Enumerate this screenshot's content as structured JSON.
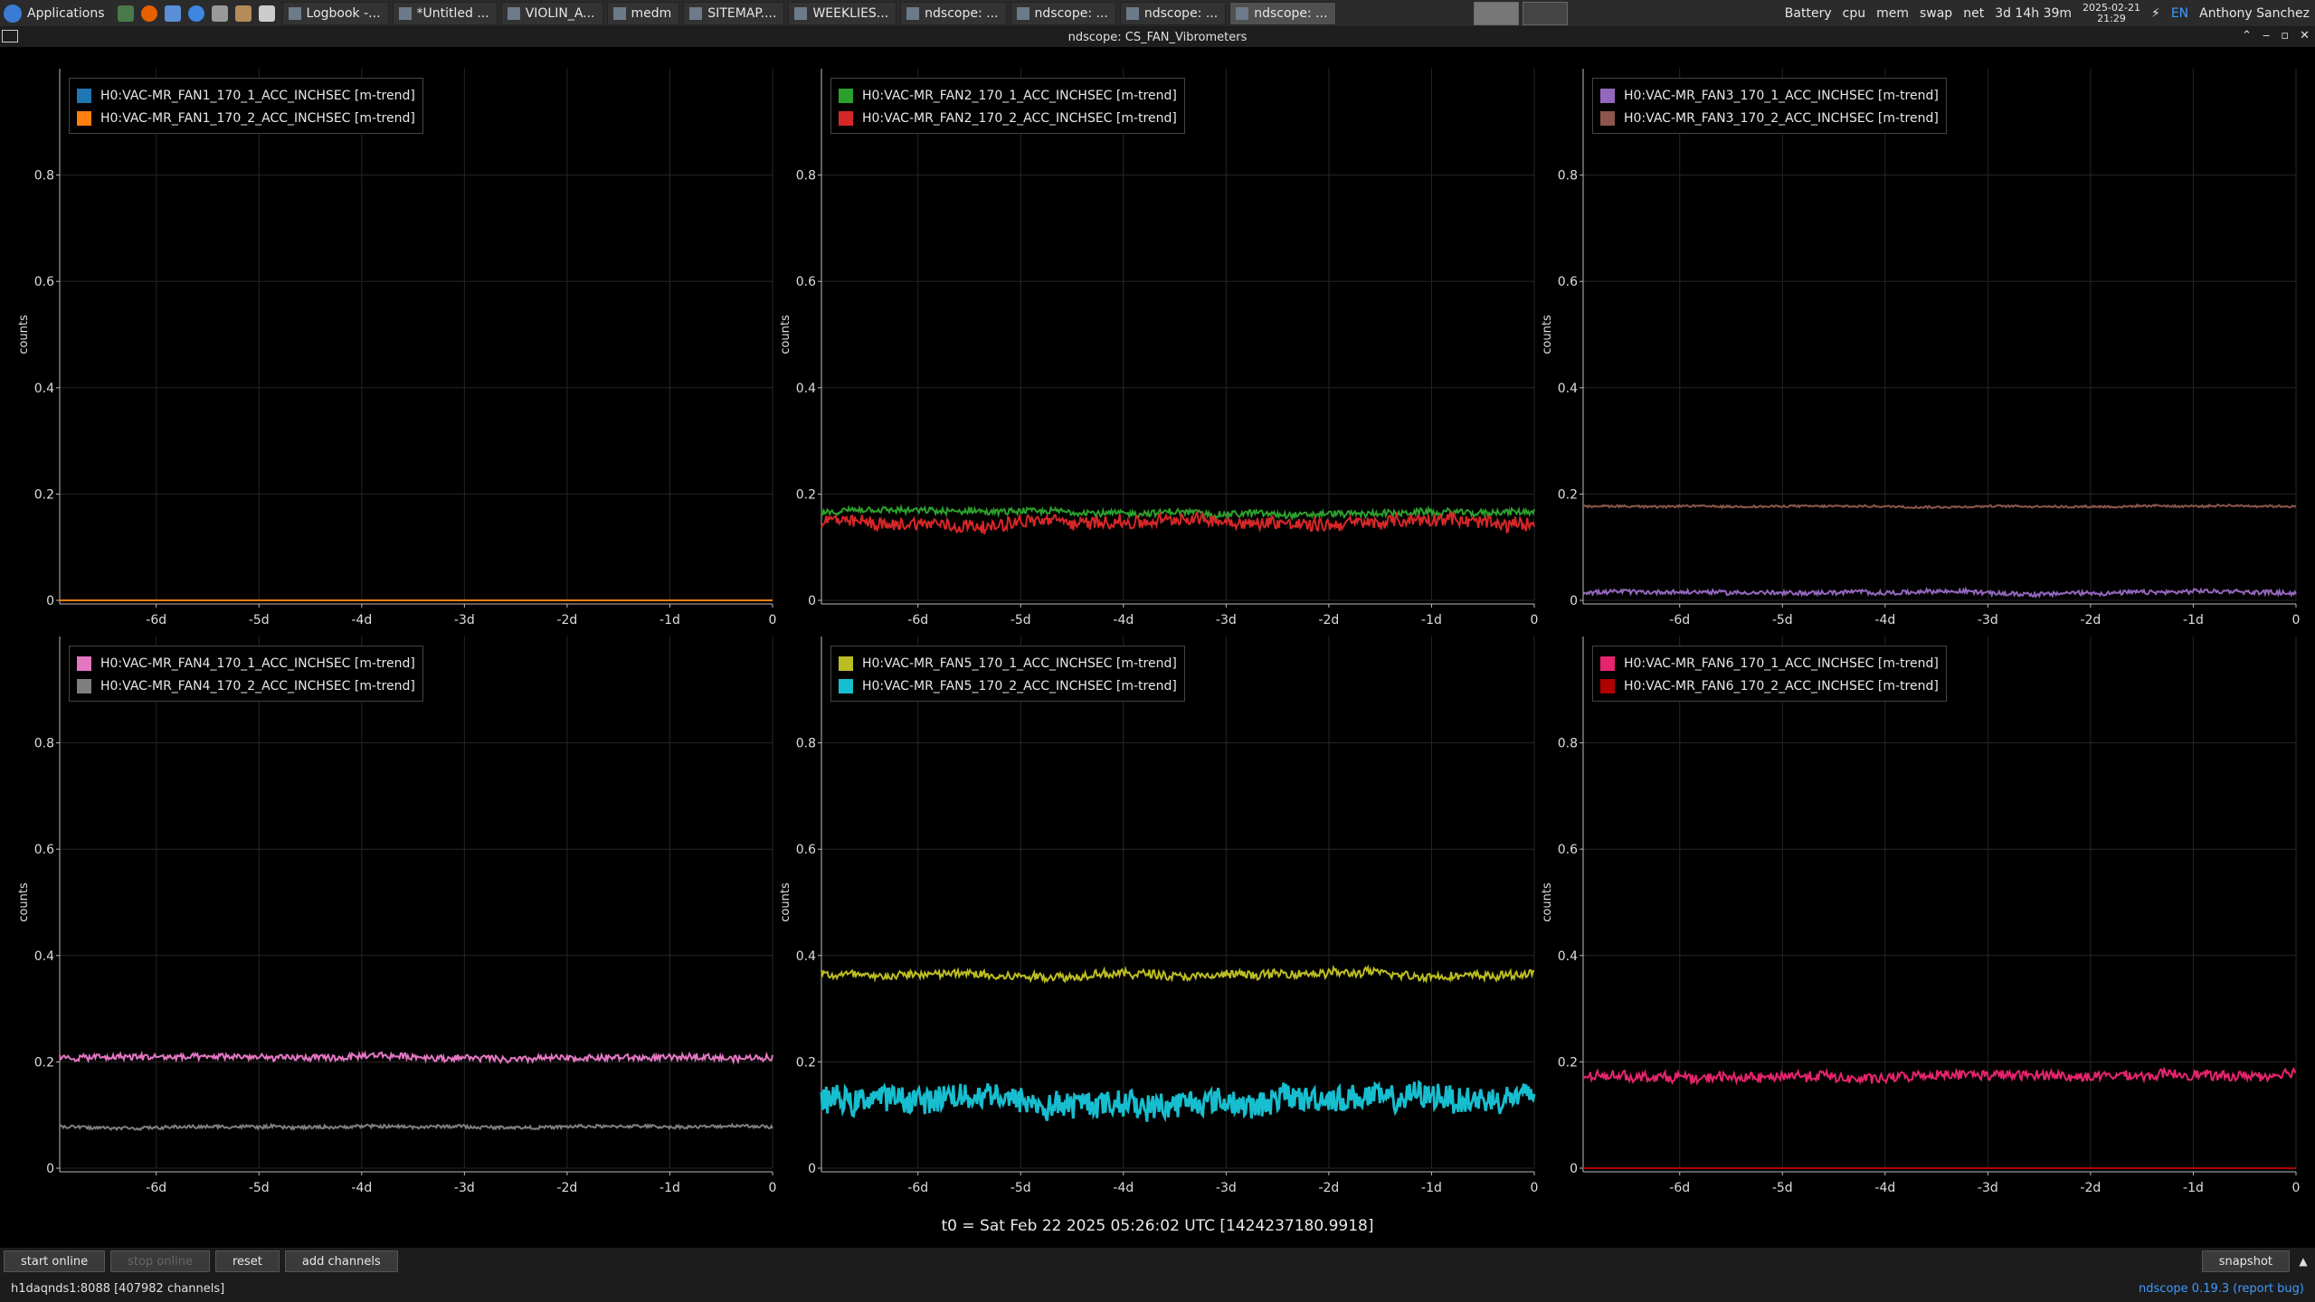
{
  "taskbar": {
    "apps_label": "Applications",
    "tasks": [
      {
        "label": "Logbook -..."
      },
      {
        "label": "*Untitled ..."
      },
      {
        "label": "VIOLIN_A..."
      },
      {
        "label": "medm"
      },
      {
        "label": "SITEMAP...."
      },
      {
        "label": "WEEKLIES..."
      },
      {
        "label": "ndscope: ..."
      },
      {
        "label": "ndscope: ..."
      },
      {
        "label": "ndscope: ..."
      },
      {
        "label": "ndscope: ..."
      }
    ],
    "battery": "Battery",
    "cpu": "cpu",
    "mem": "mem",
    "swap": "swap",
    "net": "net",
    "uptime": "3d 14h 39m",
    "date": "2025-02-21",
    "time": "21:29",
    "lang": "EN",
    "user": "Anthony Sanchez"
  },
  "window": {
    "title": "ndscope: CS_FAN_Vibrometers"
  },
  "colors": {
    "accent": "#3d9bff"
  },
  "chart_data": [
    {
      "type": "line",
      "ylabel": "counts",
      "ylim": [
        0,
        1
      ],
      "yticks": [
        "0",
        "0.2",
        "0.4",
        "0.6",
        "0.8"
      ],
      "xticks": [
        "-6d",
        "-5d",
        "-4d",
        "-3d",
        "-2d",
        "-1d",
        "0"
      ],
      "xlim": [
        -6.94,
        0
      ],
      "legend_position": "top-left",
      "series": [
        {
          "name": "H0:VAC-MR_FAN1_170_1_ACC_INCHSEC [m-trend]",
          "color": "#1f77b4",
          "level": 0.0,
          "noise": 0.0
        },
        {
          "name": "H0:VAC-MR_FAN1_170_2_ACC_INCHSEC [m-trend]",
          "color": "#ff7f0e",
          "level": 0.0,
          "noise": 0.0
        }
      ]
    },
    {
      "type": "line",
      "ylabel": "counts",
      "ylim": [
        0,
        1
      ],
      "yticks": [
        "0",
        "0.2",
        "0.4",
        "0.6",
        "0.8"
      ],
      "xticks": [
        "-6d",
        "-5d",
        "-4d",
        "-3d",
        "-2d",
        "-1d",
        "0"
      ],
      "xlim": [
        -6.94,
        0
      ],
      "legend_position": "top-left",
      "series": [
        {
          "name": "H0:VAC-MR_FAN2_170_1_ACC_INCHSEC [m-trend]",
          "color": "#2ca02c",
          "level": 0.165,
          "noise": 0.006
        },
        {
          "name": "H0:VAC-MR_FAN2_170_2_ACC_INCHSEC [m-trend]",
          "color": "#d62728",
          "level": 0.148,
          "noise": 0.012
        }
      ]
    },
    {
      "type": "line",
      "ylabel": "counts",
      "ylim": [
        0,
        1
      ],
      "yticks": [
        "0",
        "0.2",
        "0.4",
        "0.6",
        "0.8"
      ],
      "xticks": [
        "-6d",
        "-5d",
        "-4d",
        "-3d",
        "-2d",
        "-1d",
        "0"
      ],
      "xlim": [
        -6.94,
        0
      ],
      "legend_position": "top-left",
      "series": [
        {
          "name": "H0:VAC-MR_FAN3_170_1_ACC_INCHSEC [m-trend]",
          "color": "#9467bd",
          "level": 0.015,
          "noise": 0.004
        },
        {
          "name": "H0:VAC-MR_FAN3_170_2_ACC_INCHSEC [m-trend]",
          "color": "#8c564b",
          "level": 0.177,
          "noise": 0.002
        }
      ]
    },
    {
      "type": "line",
      "ylabel": "counts",
      "ylim": [
        0,
        1
      ],
      "yticks": [
        "0",
        "0.2",
        "0.4",
        "0.6",
        "0.8"
      ],
      "xticks": [
        "-6d",
        "-5d",
        "-4d",
        "-3d",
        "-2d",
        "-1d",
        "0"
      ],
      "xlim": [
        -6.94,
        0
      ],
      "legend_position": "top-left",
      "series": [
        {
          "name": "H0:VAC-MR_FAN4_170_1_ACC_INCHSEC [m-trend]",
          "color": "#e377c2",
          "level": 0.208,
          "noise": 0.006
        },
        {
          "name": "H0:VAC-MR_FAN4_170_2_ACC_INCHSEC [m-trend]",
          "color": "#7f7f7f",
          "level": 0.078,
          "noise": 0.003
        }
      ]
    },
    {
      "type": "line",
      "ylabel": "counts",
      "ylim": [
        0,
        1
      ],
      "yticks": [
        "0",
        "0.2",
        "0.4",
        "0.6",
        "0.8"
      ],
      "xticks": [
        "-6d",
        "-5d",
        "-4d",
        "-3d",
        "-2d",
        "-1d",
        "0"
      ],
      "xlim": [
        -6.94,
        0
      ],
      "legend_position": "top-left",
      "series": [
        {
          "name": "H0:VAC-MR_FAN5_170_1_ACC_INCHSEC [m-trend]",
          "color": "#bcbd22",
          "level": 0.365,
          "noise": 0.008
        },
        {
          "name": "H0:VAC-MR_FAN5_170_2_ACC_INCHSEC [m-trend]",
          "color": "#17becf",
          "level": 0.13,
          "noise": 0.025
        }
      ]
    },
    {
      "type": "line",
      "ylabel": "counts",
      "ylim": [
        0,
        1
      ],
      "yticks": [
        "0",
        "0.2",
        "0.4",
        "0.6",
        "0.8"
      ],
      "xticks": [
        "-6d",
        "-5d",
        "-4d",
        "-3d",
        "-2d",
        "-1d",
        "0"
      ],
      "xlim": [
        -6.94,
        0
      ],
      "legend_position": "top-left",
      "series": [
        {
          "name": "H0:VAC-MR_FAN6_170_1_ACC_INCHSEC [m-trend]",
          "color": "#e6246e",
          "level": 0.172,
          "noise": 0.009
        },
        {
          "name": "H0:VAC-MR_FAN6_170_2_ACC_INCHSEC [m-trend]",
          "color": "#b00000",
          "level": 0.0,
          "noise": 0.0
        }
      ]
    }
  ],
  "t0_label": "t0 = Sat Feb 22 2025 05:26:02 UTC [1424237180.9918]",
  "toolbar": {
    "start_online": "start online",
    "stop_online": "stop online",
    "reset": "reset",
    "add_channels": "add channels",
    "snapshot": "snapshot"
  },
  "status": {
    "server": "h1daqnds1:8088  [407982 channels]",
    "version": "ndscope 0.19.3 (report bug)"
  }
}
